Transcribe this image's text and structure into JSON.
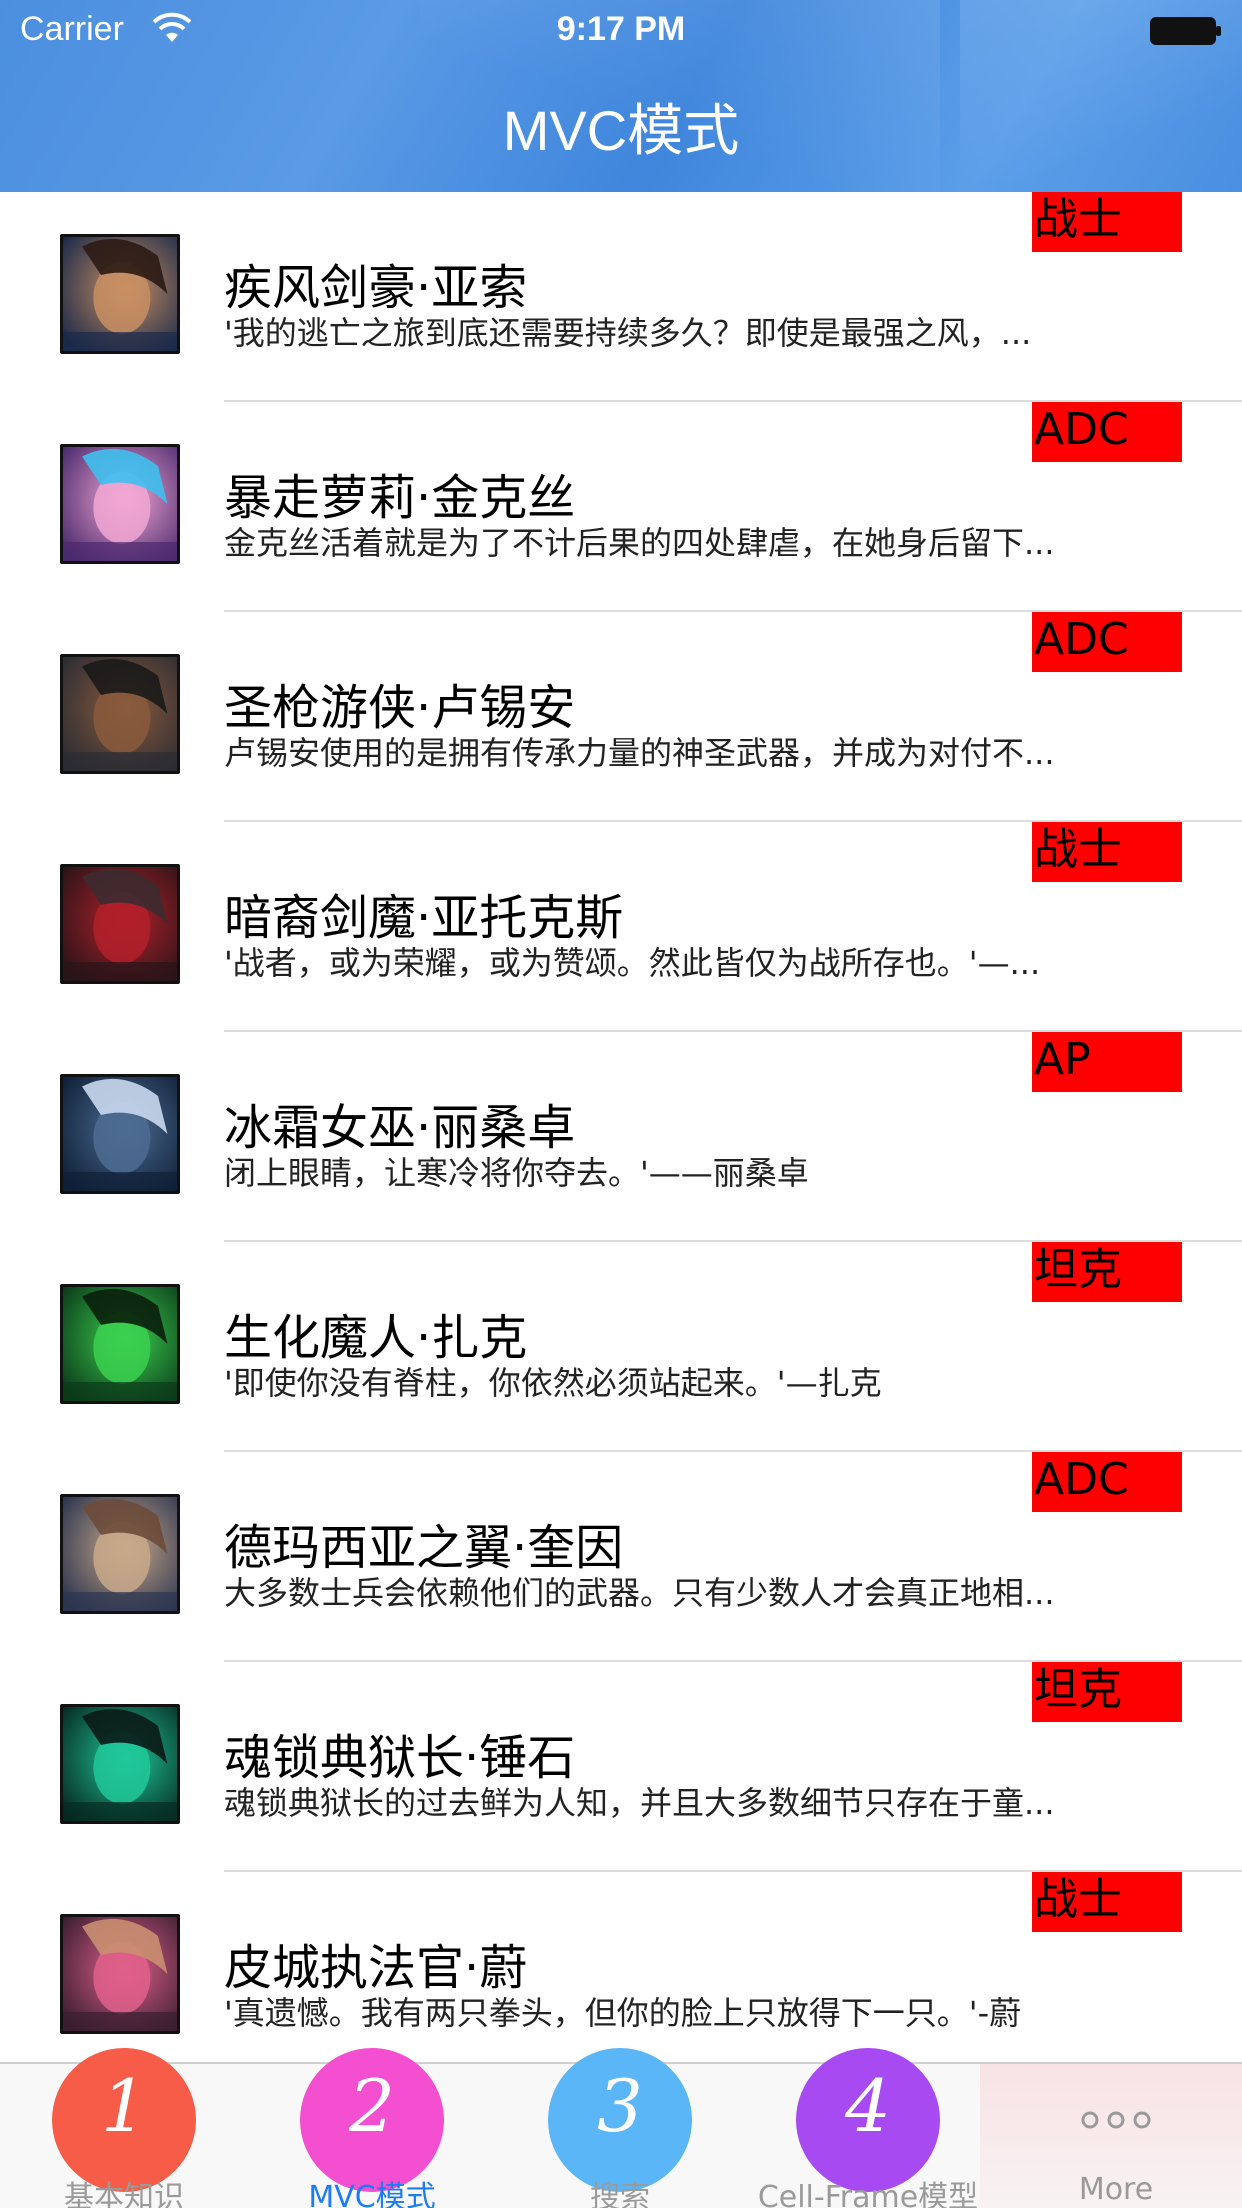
{
  "status_bar": {
    "carrier": "Carrier",
    "time": "9:17 PM"
  },
  "nav": {
    "title": "MVC模式"
  },
  "heroes": [
    {
      "name": "疾风剑豪·亚索",
      "desc": "'我的逃亡之旅到底还需要持续多久？即使是最强之风，...",
      "tag": "战士",
      "icon": "yasuo-portrait-icon"
    },
    {
      "name": "暴走萝莉·金克丝",
      "desc": "金克丝活着就是为了不计后果的四处肆虐，在她身后留下...",
      "tag": "ADC",
      "icon": "jinx-portrait-icon"
    },
    {
      "name": "圣枪游侠·卢锡安",
      "desc": "卢锡安使用的是拥有传承力量的神圣武器，并成为对付不...",
      "tag": "ADC",
      "icon": "lucian-portrait-icon"
    },
    {
      "name": "暗裔剑魔·亚托克斯",
      "desc": "'战者，或为荣耀，或为赞颂。然此皆仅为战所存也。'—...",
      "tag": "战士",
      "icon": "aatrox-portrait-icon"
    },
    {
      "name": "冰霜女巫·丽桑卓",
      "desc": "闭上眼睛，让寒冷将你夺去。'——丽桑卓",
      "tag": "AP",
      "icon": "lissandra-portrait-icon"
    },
    {
      "name": "生化魔人·扎克",
      "desc": "'即使你没有脊柱，你依然必须站起来。'—扎克",
      "tag": "坦克",
      "icon": "zac-portrait-icon"
    },
    {
      "name": "德玛西亚之翼·奎因",
      "desc": "大多数士兵会依赖他们的武器。只有少数人才会真正地相...",
      "tag": "ADC",
      "icon": "quinn-portrait-icon"
    },
    {
      "name": "魂锁典狱长·锤石",
      "desc": "魂锁典狱长的过去鲜为人知，并且大多数细节只存在于童...",
      "tag": "坦克",
      "icon": "thresh-portrait-icon"
    },
    {
      "name": "皮城执法官·蔚",
      "desc": "'真遗憾。我有两只拳头，但你的脸上只放得下一只。'-蔚",
      "tag": "战士",
      "icon": "vi-portrait-icon"
    }
  ],
  "tabs": [
    {
      "number": "1",
      "label": "基本知识",
      "color": "#f65c48",
      "active": false
    },
    {
      "number": "2",
      "label": "MVC模式",
      "color": "#f44fd0",
      "active": true
    },
    {
      "number": "3",
      "label": "搜索",
      "color": "#5bb6f7",
      "active": false
    },
    {
      "number": "4",
      "label": "Cell-Frame模型",
      "color": "#a84af1",
      "active": false
    },
    {
      "number": "",
      "label": "More",
      "color": "",
      "active": false,
      "icon": "more-dots-icon"
    }
  ],
  "colors": {
    "nav_blue": "#4a8fe0",
    "tag_red": "#ff0000",
    "active_tab": "#1e7cf2",
    "inactive_tab": "#9a9a9a"
  }
}
